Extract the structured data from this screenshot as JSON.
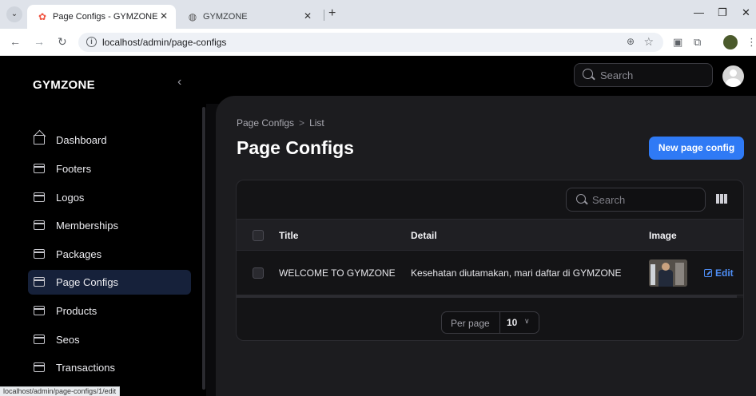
{
  "browser": {
    "tabs": [
      {
        "title": "Page Configs - GYMZONE",
        "close": "✕"
      },
      {
        "title": "GYMZONE",
        "close": "✕"
      }
    ],
    "new_tab": "+",
    "url": "localhost/admin/page-configs",
    "status_url": "localhost/admin/page-configs/1/edit"
  },
  "app": {
    "brand": "GYMZONE",
    "collapse_icon": "‹",
    "search_placeholder": "Search"
  },
  "sidebar": {
    "items": [
      {
        "label": "Dashboard",
        "icon": "home-icon"
      },
      {
        "label": "Footers",
        "icon": "inbox-icon"
      },
      {
        "label": "Logos",
        "icon": "inbox-icon"
      },
      {
        "label": "Memberships",
        "icon": "inbox-icon"
      },
      {
        "label": "Packages",
        "icon": "inbox-icon"
      },
      {
        "label": "Page Configs",
        "icon": "inbox-icon",
        "active": true
      },
      {
        "label": "Products",
        "icon": "inbox-icon"
      },
      {
        "label": "Seos",
        "icon": "inbox-icon"
      },
      {
        "label": "Transactions",
        "icon": "inbox-icon"
      }
    ]
  },
  "page": {
    "breadcrumb": [
      "Page Configs",
      "List"
    ],
    "breadcrumb_sep": ">",
    "title": "Page Configs",
    "new_button": "New page config"
  },
  "table": {
    "search_placeholder": "Search",
    "columns": [
      "Title",
      "Detail",
      "Image"
    ],
    "rows": [
      {
        "title": "WELCOME TO GYMZONE",
        "detail": "Kesehatan diutamakan, mari daftar di GYMZONE",
        "action": "Edit"
      }
    ],
    "per_page_label": "Per page",
    "per_page_value": "10"
  },
  "colors": {
    "accent": "#2f7af5",
    "active_nav": "#16213a",
    "panel": "#1c1c1f"
  }
}
